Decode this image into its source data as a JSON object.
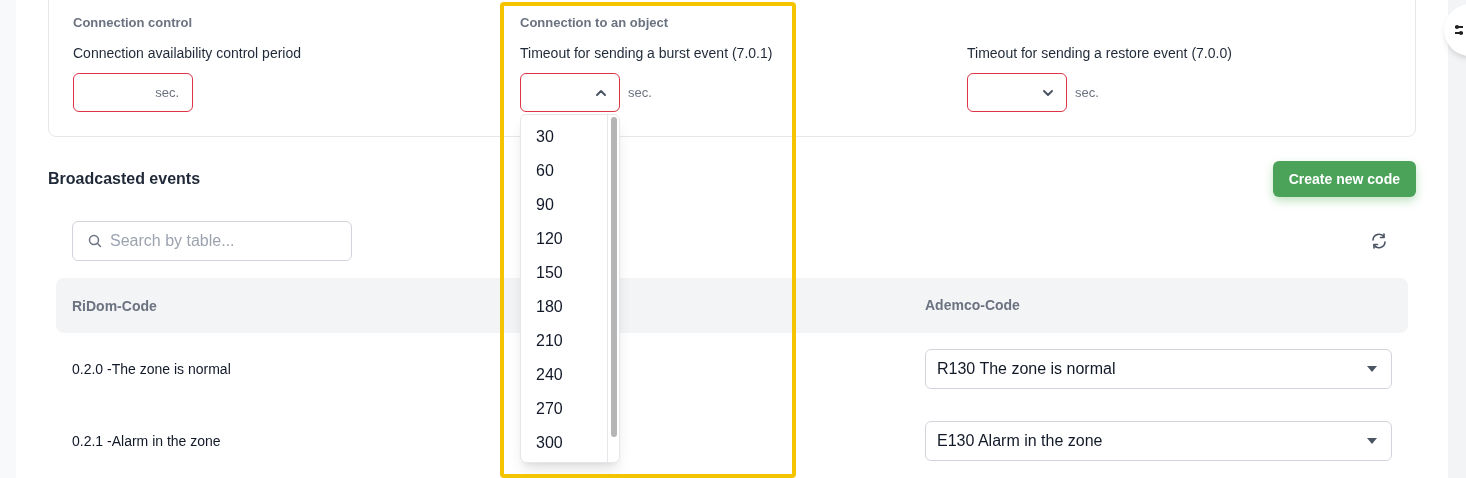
{
  "settings_card": {
    "columns": [
      {
        "heading": "Connection control",
        "label": "Connection availability control period",
        "field": {
          "kind": "input",
          "unit_inside": "sec.",
          "invalid": true
        }
      },
      {
        "heading": "Connection to an object",
        "label": "Timeout for sending a burst event (7.0.1)",
        "field": {
          "kind": "select",
          "expanded": true,
          "unit": "sec.",
          "invalid": true,
          "options": [
            "30",
            "60",
            "90",
            "120",
            "150",
            "180",
            "210",
            "240",
            "270",
            "300"
          ]
        }
      },
      {
        "label": "Timeout for sending a restore event (7.0.0)",
        "field": {
          "kind": "select",
          "expanded": false,
          "unit": "sec.",
          "invalid": true
        }
      }
    ]
  },
  "section_title": "Broadcasted events",
  "create_button": "Create new code",
  "search": {
    "placeholder": "Search by table..."
  },
  "table": {
    "columns": [
      "RiDom-Code",
      "Ademco-Code"
    ],
    "rows": [
      {
        "ridom": "0.2.0 -The zone is normal",
        "ademco": "R130 The zone is normal"
      },
      {
        "ridom": "0.2.1 -Alarm in the zone",
        "ademco": "E130 Alarm in the zone"
      }
    ]
  },
  "highlight": {
    "on": true
  }
}
